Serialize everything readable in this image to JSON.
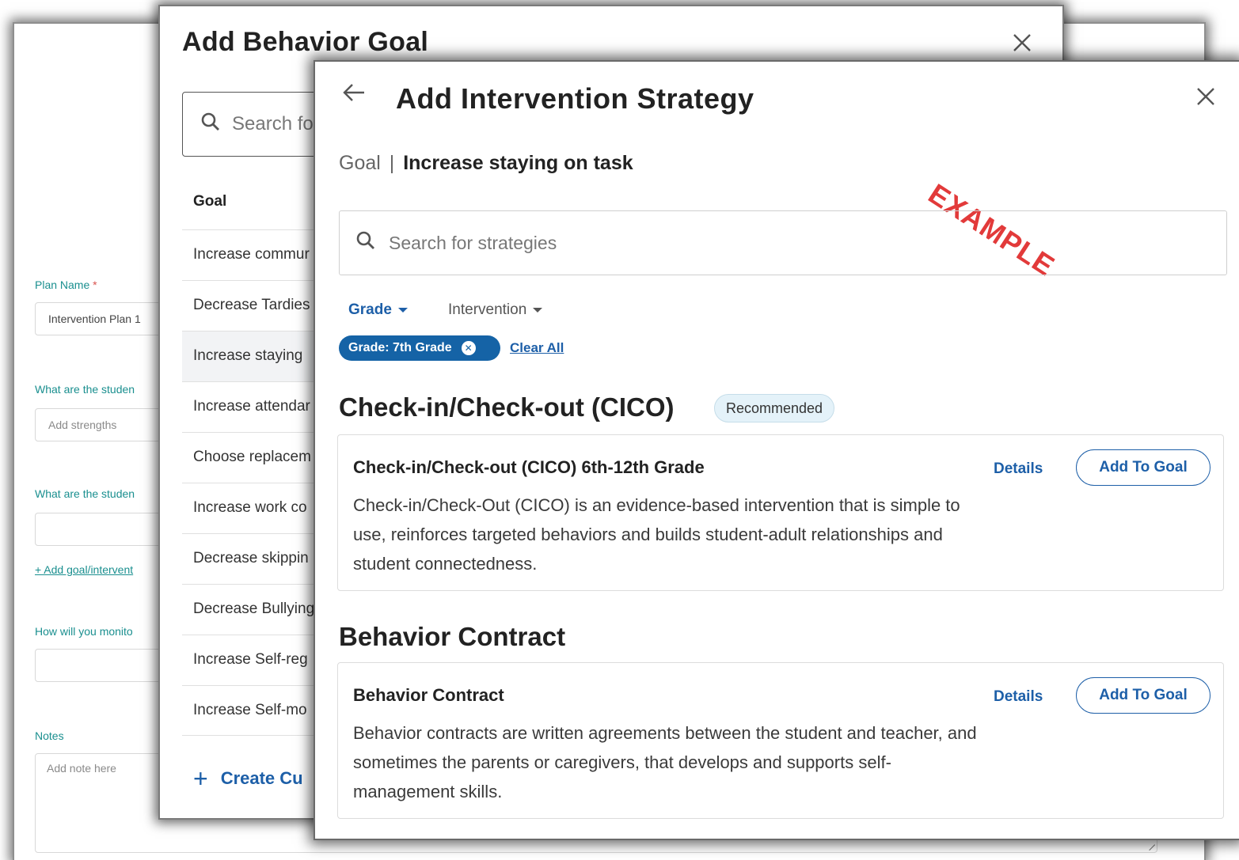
{
  "plan_form": {
    "plan_name_label": "Plan Name",
    "required_mark": "*",
    "plan_name_value": "Intervention Plan 1",
    "strengths_label": "What are the studen",
    "strengths_placeholder": "Add strengths",
    "second_question_label": "What are the studen",
    "add_goal_link": "+ Add goal/intervent",
    "monitor_label": "How will you monito",
    "notes_label": "Notes",
    "notes_placeholder": "Add note here"
  },
  "behavior_goal_dialog": {
    "title": "Add Behavior Goal",
    "close_icon": "close-icon",
    "search_placeholder": "Search fo",
    "column_header": "Goal",
    "goals": [
      "Increase commur",
      "Decrease Tardies",
      "Increase staying",
      "Increase attendar",
      "Choose replacem",
      "Increase work co",
      "Decrease skippin",
      "Decrease Bullying",
      "Increase Self-reg",
      "Increase Self-mo"
    ],
    "selected_goal_index": 2,
    "create_label": "Create Cu"
  },
  "strategy_dialog": {
    "title": "Add Intervention Strategy",
    "back_icon": "arrow-left-icon",
    "close_icon": "close-icon",
    "goal_label": "Goal",
    "goal_separator": "|",
    "goal_value": "Increase staying on task",
    "stamp": "EXAMPLE",
    "search_placeholder": "Search for strategies",
    "filters": {
      "grade": "Grade",
      "intervention": "Intervention"
    },
    "active_chip": "Grade: 7th Grade",
    "clear_all": "Clear All",
    "sections": [
      {
        "title": "Check-in/Check-out (CICO)",
        "badge": "Recommended",
        "card_title": "Check-in/Check-out (CICO) 6th-12th Grade",
        "card_description": "Check-in/Check-Out (CICO) is an evidence-based intervention that is simple to use, reinforces targeted behaviors and builds student-adult relationships and student connectedness.",
        "details": "Details",
        "add": "Add To Goal"
      },
      {
        "title": "Behavior Contract",
        "badge": "",
        "card_title": "Behavior Contract",
        "card_description": "Behavior contracts are written agreements between the student and teacher, and sometimes the parents or caregivers, that develops and supports self-management skills.",
        "details": "Details",
        "add": "Add To Goal"
      }
    ]
  },
  "colors": {
    "accent_blue": "#1d5fa8",
    "chip_blue": "#1563a6",
    "teal_label": "#1a8f8f",
    "stamp_red": "#e23a3a",
    "badge_bg": "#e4f2f9"
  }
}
